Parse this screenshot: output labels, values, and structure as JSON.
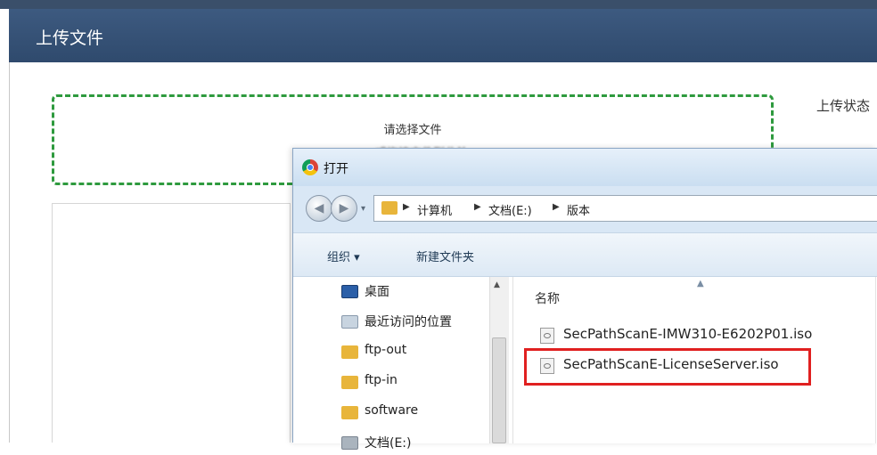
{
  "modal": {
    "title": "上传文件",
    "drop_zone_text": "请选择文件",
    "drop_zone_subtext": "或拖拽文件到此处",
    "upload_status_label": "上传状态"
  },
  "dialog": {
    "title": "打开",
    "address_path": [
      "计算机",
      "文档(E:)",
      "版本"
    ],
    "toolbar": {
      "organize": "组织 ▾",
      "new_folder": "新建文件夹"
    },
    "nav_items": [
      {
        "label": "桌面",
        "icon": "desktop-icon"
      },
      {
        "label": "最近访问的位置",
        "icon": "recent-places-icon"
      },
      {
        "label": "ftp-out",
        "icon": "folder-icon"
      },
      {
        "label": "ftp-in",
        "icon": "folder-icon"
      },
      {
        "label": "software",
        "icon": "folder-icon"
      },
      {
        "label": "文档(E:)",
        "icon": "drive-icon"
      }
    ],
    "column_header": "名称",
    "files": [
      {
        "name": "SecPathScanE-IMW310-E6202P01.iso",
        "icon": "iso-file-icon"
      },
      {
        "name": "SecPathScanE-LicenseServer.iso",
        "icon": "iso-file-icon",
        "highlighted": true
      }
    ]
  },
  "colors": {
    "highlight": "#e02020",
    "drop_zone_border": "#2e9a3e",
    "header": "#34527a"
  }
}
